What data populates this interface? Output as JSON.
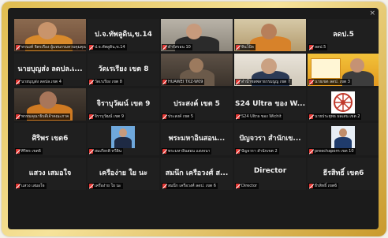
{
  "window": {
    "close_glyph": "×"
  },
  "tiles": [
    {
      "id": "t1",
      "name": "",
      "label": "ทรนงค์ จิตรเรือง ผู้แทนกรมควบคุมคุณภาพสิ่งแวดล้อม",
      "kind": "video-monk"
    },
    {
      "id": "t2",
      "name": "ป.จ.ทัพลูดิน,ข.14",
      "label": "ป.จ.ทัพลูดิน,ข.14",
      "kind": "name"
    },
    {
      "id": "t3",
      "name": "",
      "label": "ดำรัสรอน 10",
      "kind": "video-man"
    },
    {
      "id": "t4",
      "name": "",
      "label": "ทินโป้ด",
      "kind": "video-monk-active"
    },
    {
      "id": "t5",
      "name": "ลดป.5",
      "label": "ลดป.5",
      "kind": "name"
    },
    {
      "id": "t6",
      "name": "นายบุญส่ง ลดปล.เ...",
      "label": "นายบุญส่ง ลดปล.เขต 4",
      "kind": "name"
    },
    {
      "id": "t7",
      "name": "วัดเรเรียง เขต 8",
      "label": "วัดเรเรียง เขต 8",
      "kind": "name"
    },
    {
      "id": "t8",
      "name": "",
      "label": "HUAWEI TXZ-W09",
      "kind": "video-room"
    },
    {
      "id": "t9",
      "name": "",
      "label": "ดำน้ำชลพลาธรรมนูญ เขต 7",
      "kind": "video-young"
    },
    {
      "id": "t10",
      "name": "",
      "label": "นายเขต ลดป. เขต 3",
      "kind": "video-poster"
    },
    {
      "id": "t11",
      "name": "",
      "label": "พรหมคุณาธิบดีเจ้าคณะภาค",
      "kind": "video-monk2"
    },
    {
      "id": "t12",
      "name": "จิราบุวัฒน์ เขต 9",
      "label": "จิราบุวัฒน์ เขต 9",
      "kind": "name"
    },
    {
      "id": "t13",
      "name": "ประสงค์ เขต 5",
      "label": "ประสงค์ เขต 5",
      "kind": "name"
    },
    {
      "id": "t14",
      "name": "S24 Ultra ของ W...",
      "label": "S24 Ultra ของ Wichit",
      "kind": "name"
    },
    {
      "id": "t15",
      "name": "",
      "label": "นายประยุทธ ผลเสน เขต 2",
      "kind": "avatar-dharma"
    },
    {
      "id": "t16",
      "name": "ศิริพร เขต6",
      "label": "ศิริพร เขต6",
      "kind": "name"
    },
    {
      "id": "t17",
      "name": "",
      "label": "สมเกียรติ ทวีลิน",
      "kind": "avatar-man"
    },
    {
      "id": "t18",
      "name": "พระมหาอินสอน...",
      "label": "พระมหาอินสอน แสงจนา",
      "kind": "name"
    },
    {
      "id": "t19",
      "name": "ปัญจวรา สำนักเข...",
      "label": "ปัญจวรา สำนักเขต 2",
      "kind": "name"
    },
    {
      "id": "t20",
      "name": "",
      "label": "preechaporn เขต 10",
      "kind": "avatar-suit"
    },
    {
      "id": "t21",
      "name": "แสวง เสมอใจ",
      "label": "แสวง เสมอใจ",
      "kind": "name"
    },
    {
      "id": "t22",
      "name": "เครือง่าย ใย นะ",
      "label": "เครือง่าย ใย นะ",
      "kind": "name"
    },
    {
      "id": "t23",
      "name": "สมนึก เครือวงศ์ ส...",
      "label": "สมนึก เครือวงศ์ ลดป. เขต 6",
      "kind": "name"
    },
    {
      "id": "t24",
      "name": "Director",
      "label": "Director",
      "kind": "name"
    },
    {
      "id": "t25",
      "name": "ธีรสิทธิ์ เขต6",
      "label": "ธีรสิทธิ์ เขต6",
      "kind": "name"
    }
  ]
}
